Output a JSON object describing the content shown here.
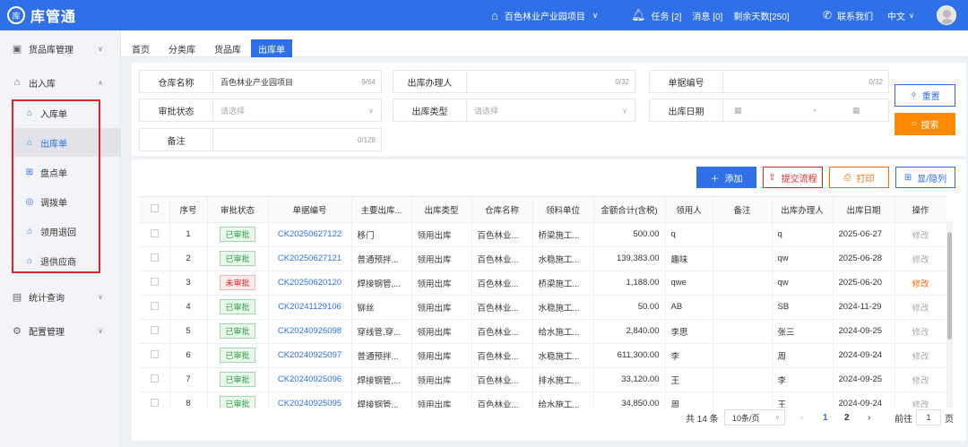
{
  "header": {
    "logo_badge": "库",
    "logo_text": "库管通",
    "project": "百色林业产业园项目",
    "tasks": "任务 [2]",
    "messages": "消息 [0]",
    "days_left": "剩余天数[250]",
    "contact": "联系我们",
    "language": "中文"
  },
  "sidebar": {
    "groups": [
      {
        "label": "货品库管理",
        "icon": "box-icon"
      },
      {
        "label": "出入库",
        "icon": "warehouse-icon"
      },
      {
        "label": "统计查询",
        "icon": "chart-icon"
      },
      {
        "label": "配置管理",
        "icon": "settings-icon"
      }
    ],
    "items": [
      {
        "label": "入库单"
      },
      {
        "label": "出库单"
      },
      {
        "label": "盘点单"
      },
      {
        "label": "调拨单"
      },
      {
        "label": "领用退回"
      },
      {
        "label": "退供应商"
      }
    ]
  },
  "tabs": [
    "首页",
    "分类库",
    "货品库",
    "出库单"
  ],
  "filter": {
    "warehouse_label": "仓库名称",
    "warehouse_value": "百色林业产业园项目",
    "warehouse_count": "9/64",
    "handler_label": "出库办理人",
    "handler_count": "0/32",
    "doc_no_label": "单据编号",
    "doc_no_count": "0/32",
    "approval_label": "审批状态",
    "approval_placeholder": "请选择",
    "out_type_label": "出库类型",
    "out_type_placeholder": "请选择",
    "out_date_label": "出库日期",
    "out_date_sep": "-",
    "remark_label": "备注",
    "remark_count": "0/128",
    "reset": "重置",
    "search": "搜索"
  },
  "actions": {
    "add": "添加",
    "submit": "提交流程",
    "print": "打印",
    "toggle": "显/隐列"
  },
  "table": {
    "headers": [
      "序号",
      "审批状态",
      "单据编号",
      "主要出库...",
      "出库类型",
      "仓库名称",
      "领料单位",
      "金额合计(含税)",
      "领用人",
      "备注",
      "出库办理人",
      "出库日期",
      "操作"
    ],
    "rows": [
      {
        "no": "1",
        "status": "已审批",
        "ok": true,
        "doc": "CK20250627122",
        "goods": "移门",
        "type": "领用出库",
        "wh": "百色林业...",
        "unit": "桥梁施工...",
        "amount": "500.00",
        "user": "q",
        "remark": "",
        "handler": "q",
        "date": "2025-06-27",
        "op": "修改"
      },
      {
        "no": "2",
        "status": "已审批",
        "ok": true,
        "doc": "CK20250627121",
        "goods": "普通预拌...",
        "type": "领用出库",
        "wh": "百色林业...",
        "unit": "水稳施工...",
        "amount": "139,383.00",
        "user": "趣味",
        "remark": "",
        "handler": "qw",
        "date": "2025-06-28",
        "op": "修改"
      },
      {
        "no": "3",
        "status": "未审批",
        "ok": false,
        "doc": "CK20250620120",
        "goods": "焊接钢管,...",
        "type": "领用出库",
        "wh": "百色林业...",
        "unit": "桥梁施工...",
        "amount": "1,188.00",
        "user": "qwe",
        "remark": "",
        "handler": "qw",
        "date": "2025-06-20",
        "op": "修改"
      },
      {
        "no": "4",
        "status": "已审批",
        "ok": true,
        "doc": "CK20241129106",
        "goods": "铆丝",
        "type": "领用出库",
        "wh": "百色林业...",
        "unit": "水稳施工...",
        "amount": "50.00",
        "user": "AB",
        "remark": "",
        "handler": "SB",
        "date": "2024-11-29",
        "op": "修改"
      },
      {
        "no": "5",
        "status": "已审批",
        "ok": true,
        "doc": "CK20240926098",
        "goods": "穿线管,穿...",
        "type": "领用出库",
        "wh": "百色林业...",
        "unit": "给水施工...",
        "amount": "2,840.00",
        "user": "李思",
        "remark": "",
        "handler": "张三",
        "date": "2024-09-25",
        "op": "修改"
      },
      {
        "no": "6",
        "status": "已审批",
        "ok": true,
        "doc": "CK20240925097",
        "goods": "普通预拌...",
        "type": "领用出库",
        "wh": "百色林业...",
        "unit": "水稳施工...",
        "amount": "611,300.00",
        "user": "李",
        "remark": "",
        "handler": "周",
        "date": "2024-09-24",
        "op": "修改"
      },
      {
        "no": "7",
        "status": "已审批",
        "ok": true,
        "doc": "CK20240925096",
        "goods": "焊接钢管,...",
        "type": "领用出库",
        "wh": "百色林业...",
        "unit": "排水施工...",
        "amount": "33,120.00",
        "user": "王",
        "remark": "",
        "handler": "李",
        "date": "2024-09-25",
        "op": "修改"
      },
      {
        "no": "8",
        "status": "已审批",
        "ok": true,
        "doc": "CK20240925095",
        "goods": "焊接钢管...",
        "type": "领用出库",
        "wh": "百色林业...",
        "unit": "给水施工...",
        "amount": "34,850.00",
        "user": "周",
        "remark": "",
        "handler": "王",
        "date": "2024-09-24",
        "op": "修改"
      }
    ]
  },
  "pagination": {
    "total": "共 14 条",
    "page_size": "10条/页",
    "prev": "‹",
    "page1": "1",
    "page2": "2",
    "next": "›",
    "goto": "前往",
    "goto_value": "1",
    "unit": "页"
  },
  "colors": {
    "primary": "#2f6fe8",
    "orange": "#ff8a00",
    "danger": "#e02424",
    "success": "#2ea043"
  }
}
